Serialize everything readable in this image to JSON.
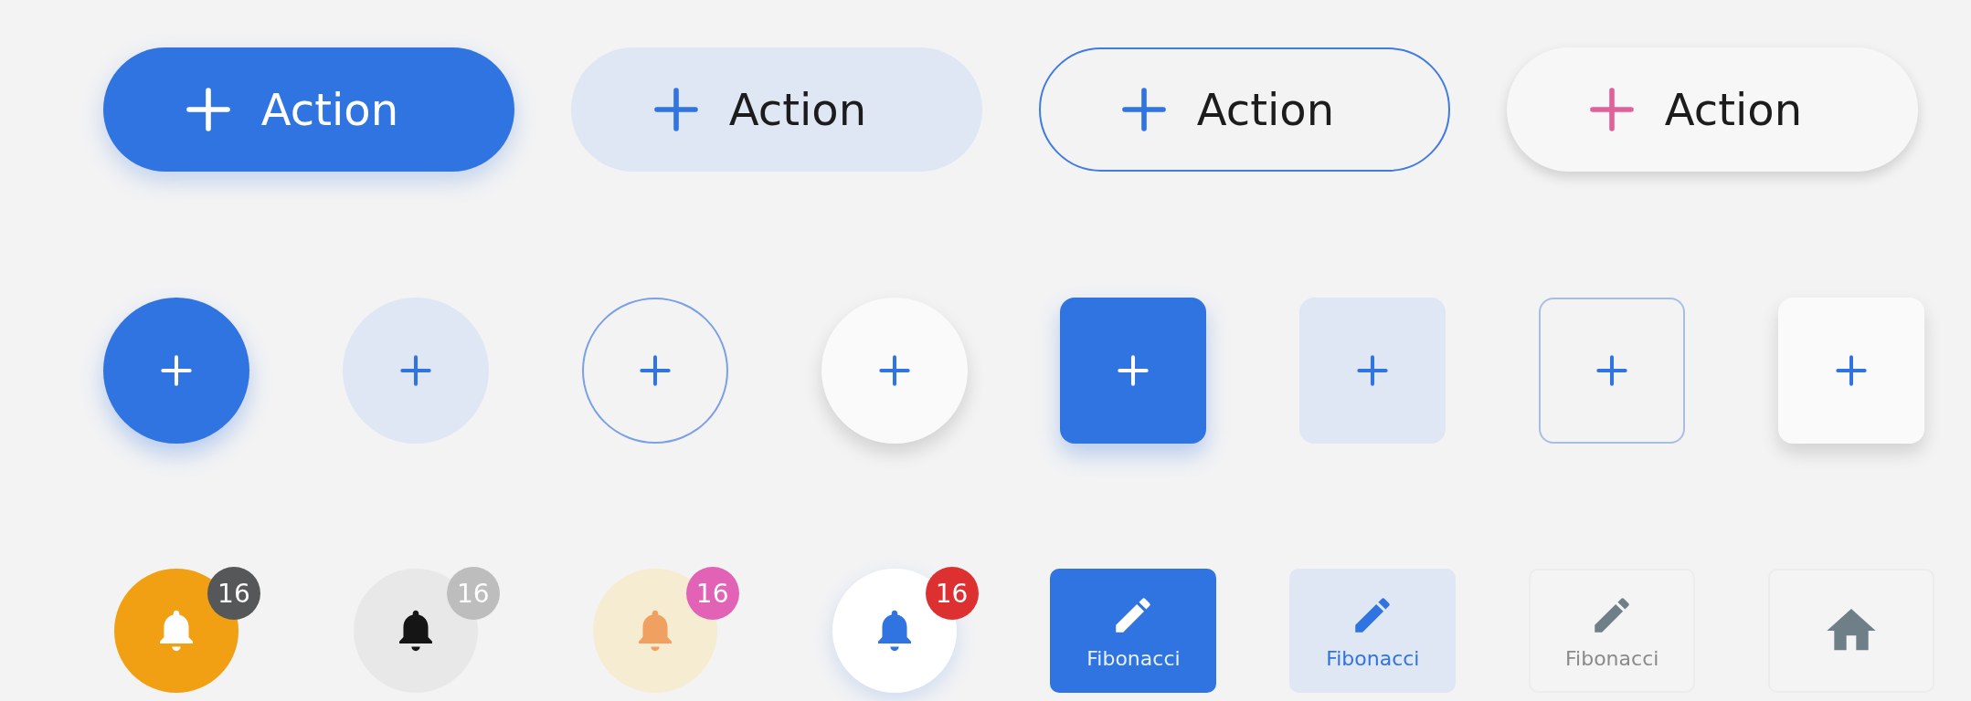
{
  "pill_buttons": [
    {
      "kind": "filled",
      "label": "Action"
    },
    {
      "kind": "tonal",
      "label": "Action"
    },
    {
      "kind": "outlined",
      "label": "Action"
    },
    {
      "kind": "elevated",
      "label": "Action"
    }
  ],
  "icon_buttons": [
    {
      "kind": "filled_circle"
    },
    {
      "kind": "tonal_circle"
    },
    {
      "kind": "outlined_circle"
    },
    {
      "kind": "elevated_circle"
    },
    {
      "kind": "filled_square"
    },
    {
      "kind": "tonal_square"
    },
    {
      "kind": "outlined_square"
    },
    {
      "kind": "elevated_square"
    }
  ],
  "bell_buttons": [
    {
      "kind": "filled",
      "count": "16",
      "color": "#555759"
    },
    {
      "kind": "tonal",
      "count": "16",
      "color": "#bdbdbd"
    },
    {
      "kind": "soft",
      "count": "16",
      "color": "#e262b6"
    },
    {
      "kind": "elevated",
      "count": "16",
      "color": "#dd3030"
    }
  ],
  "tile_buttons": [
    {
      "kind": "filled",
      "label": "Fibonacci"
    },
    {
      "kind": "tonal",
      "label": "Fibonacci"
    },
    {
      "kind": "outlined",
      "label": "Fibonacci"
    },
    {
      "kind": "home"
    }
  ]
}
